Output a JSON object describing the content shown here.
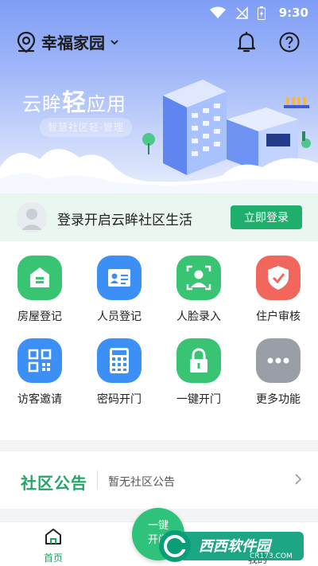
{
  "status_bar": {
    "time": "9:30"
  },
  "header": {
    "location": "幸福家园",
    "slogan_prefix": "云眸",
    "slogan_bold": "轻",
    "slogan_suffix": "应用",
    "sub_slogan": "智慧社区轻·管理"
  },
  "login": {
    "prompt": "登录开启云眸社区生活",
    "button_label": "立即登录"
  },
  "features": [
    {
      "label": "房屋登记",
      "color": "#39c474",
      "icon": "house-icon"
    },
    {
      "label": "人员登记",
      "color": "#3b8ff5",
      "icon": "id-card-icon"
    },
    {
      "label": "人脸录入",
      "color": "#39c474",
      "icon": "face-scan-icon"
    },
    {
      "label": "住户审核",
      "color": "#f2675c",
      "icon": "shield-check-icon"
    },
    {
      "label": "访客邀请",
      "color": "#3b8ff5",
      "icon": "qr-code-icon"
    },
    {
      "label": "密码开门",
      "color": "#3b8ff5",
      "icon": "keypad-icon"
    },
    {
      "label": "一键开门",
      "color": "#39c474",
      "icon": "lock-icon"
    },
    {
      "label": "更多功能",
      "color": "#9a9ea6",
      "icon": "more-icon"
    }
  ],
  "notice": {
    "title": "社区公告",
    "text": "暂无社区公告"
  },
  "tabbar": {
    "home_label": "首页",
    "center_label": "一键开门",
    "me_label": "我的"
  },
  "watermark": {
    "text": "西西软件园",
    "url": "CR173.COM"
  }
}
